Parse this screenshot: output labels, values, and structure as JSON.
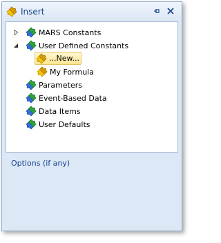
{
  "window": {
    "title": "Insert",
    "title_icon": "puzzle-icon",
    "buttons": [
      {
        "name": "pin-button",
        "icon": "pin-icon"
      },
      {
        "name": "close-button",
        "icon": "close-icon"
      }
    ]
  },
  "tree": {
    "items": [
      {
        "label": "MARS Constants",
        "expander": "collapsed",
        "icon": "puzzle-blue-green-icon"
      },
      {
        "label": "User Defined Constants",
        "expander": "expanded",
        "icon": "puzzle-blue-green-icon"
      },
      {
        "label": "...New...",
        "icon": "puzzle-yellow-icon",
        "selected": true
      },
      {
        "label": "My Formula",
        "icon": "puzzle-yellow-icon"
      },
      {
        "label": "Parameters",
        "icon": "puzzle-blue-green-icon"
      },
      {
        "label": "Event-Based Data",
        "icon": "puzzle-blue-green-icon"
      },
      {
        "label": "Data Items",
        "icon": "puzzle-blue-green-icon"
      },
      {
        "label": "User Defaults",
        "icon": "puzzle-blue-green-icon"
      }
    ]
  },
  "options": {
    "label": "Options (if any)"
  },
  "colors": {
    "title_text": "#15428b",
    "window_bg": "#dde8f6",
    "selection_bg": "#ffe58f",
    "puzzle_blue": "#2f6fd6",
    "puzzle_green": "#2ea33a",
    "puzzle_yellow": "#e2b100"
  }
}
